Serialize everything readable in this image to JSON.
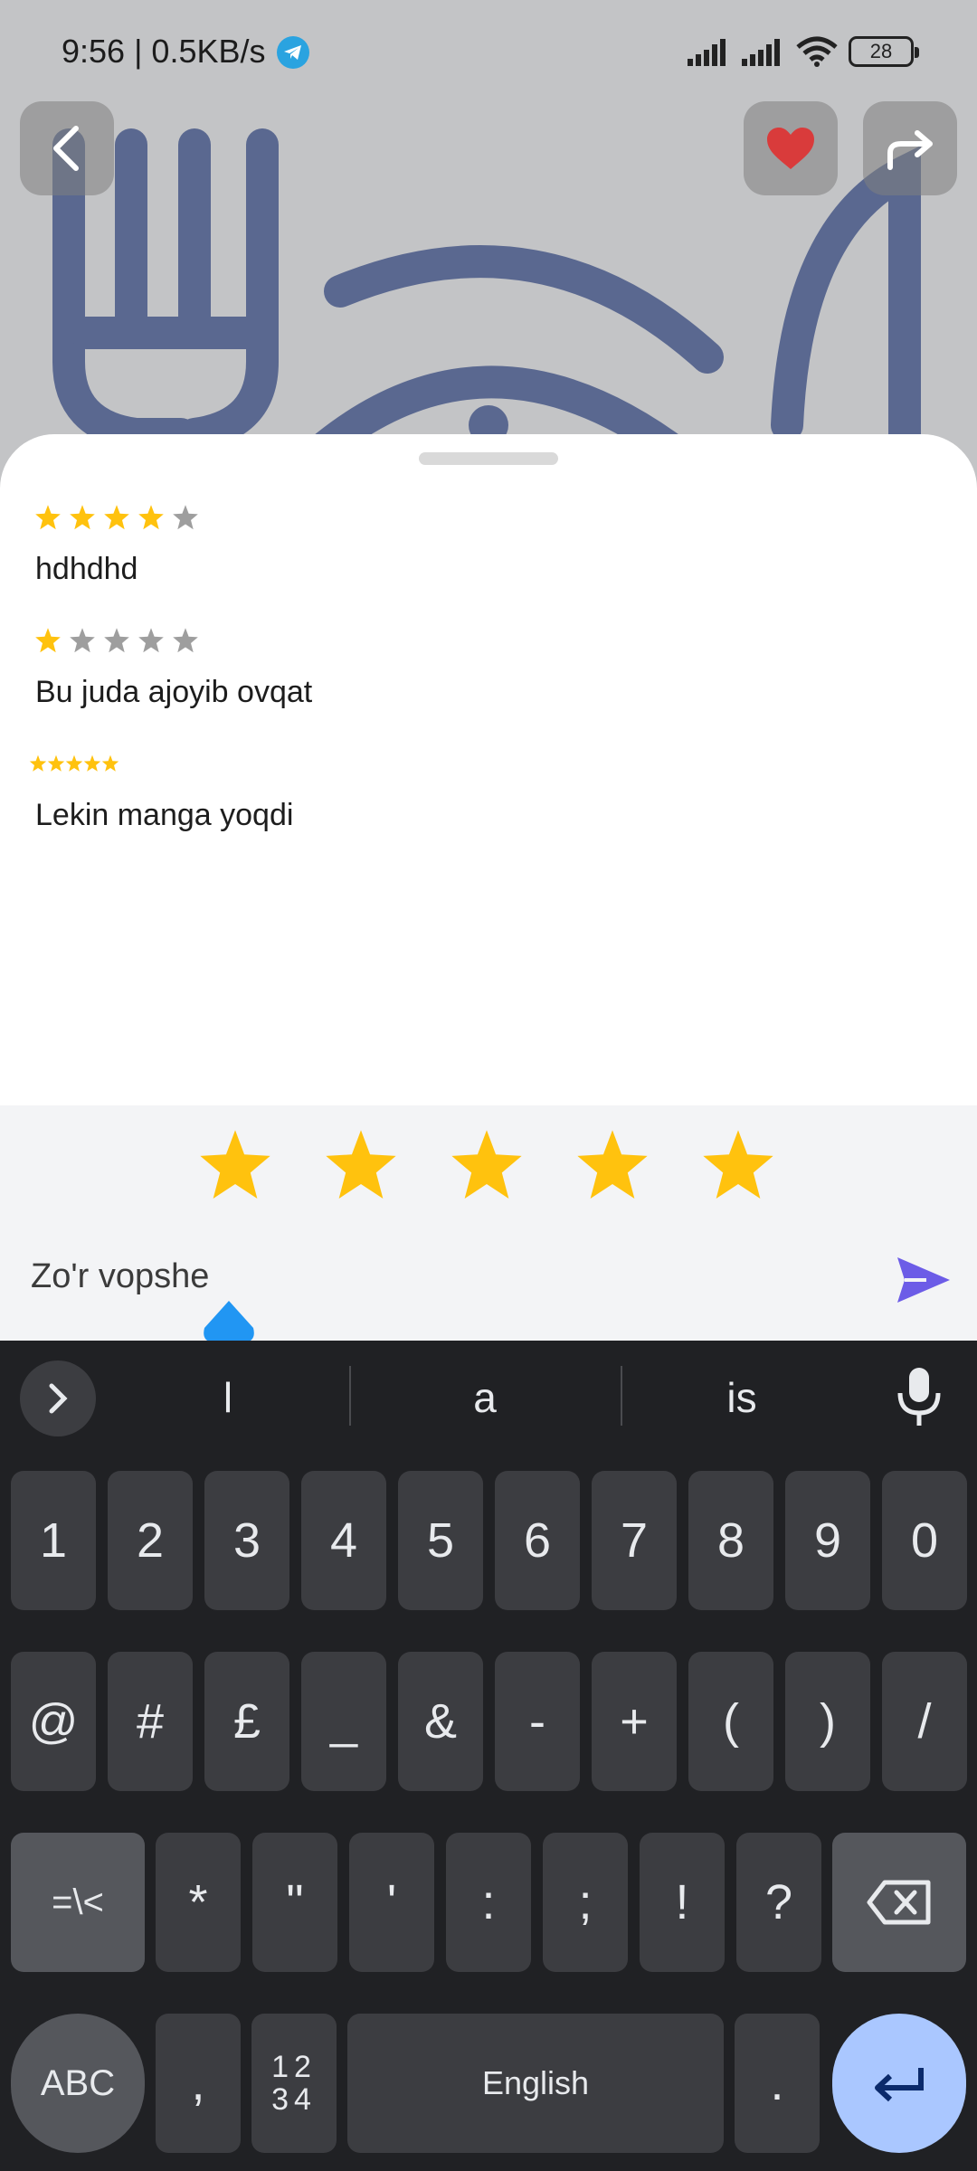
{
  "status_bar": {
    "time": "9:56 | 0.5KB/s",
    "battery": "28",
    "icons": [
      "telegram-icon",
      "signal-icon",
      "signal-icon",
      "wifi-icon",
      "battery-icon"
    ]
  },
  "header": {
    "back_icon": "chevron-left-icon",
    "favorite_icon": "heart-icon",
    "share_icon": "share-arrow-icon",
    "hero_icon": "fork-plate-knife-icon"
  },
  "reviews": [
    {
      "rating": 4,
      "max": 5,
      "text": "hdhdhd"
    },
    {
      "rating": 1,
      "max": 5,
      "text": "Bu juda ajoyib ovqat"
    },
    {
      "rating": 5,
      "max": 5,
      "text": "Lekin manga yoqdi"
    }
  ],
  "composer": {
    "rating": 5,
    "max": 5,
    "comment_value": "Zo'r vopshe",
    "send_icon": "send-icon"
  },
  "keyboard": {
    "suggestions": [
      "l",
      "a",
      "is"
    ],
    "row1": [
      "1",
      "2",
      "3",
      "4",
      "5",
      "6",
      "7",
      "8",
      "9",
      "0"
    ],
    "row2": [
      "@",
      "#",
      "£",
      "_",
      "&",
      "-",
      "+",
      "(",
      ")",
      "/"
    ],
    "row3_left": "=\\<",
    "row3": [
      "*",
      "\"",
      "'",
      ":",
      ";",
      "!",
      "?"
    ],
    "abc_label": "ABC",
    "comma": ",",
    "numsym_top": "12",
    "numsym_bottom": "34",
    "space_label": "English",
    "period": "."
  },
  "colors": {
    "star_active": "#FFC20E",
    "star_inactive": "#9E9E9E",
    "accent": "#6C5CE7",
    "hero_icon": "#5A6890",
    "heart": "#D93B3B"
  }
}
